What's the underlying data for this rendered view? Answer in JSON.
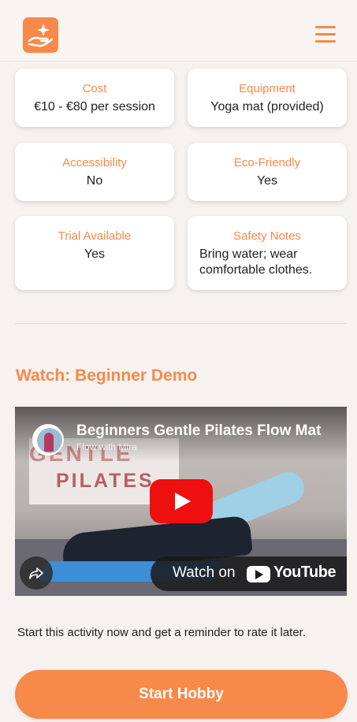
{
  "header": {
    "logo_icon": "hand-sparkle-icon",
    "menu_icon": "hamburger-menu-icon"
  },
  "details": [
    {
      "label": "Cost",
      "value": "€10 - €80 per session"
    },
    {
      "label": "Equipment",
      "value": "Yoga mat (provided)"
    },
    {
      "label": "Accessibility",
      "value": "No"
    },
    {
      "label": "Eco-Friendly",
      "value": "Yes"
    },
    {
      "label": "Trial Available",
      "value": "Yes"
    },
    {
      "label": "Safety Notes",
      "value": "Bring water; wear comfortable clothes."
    }
  ],
  "video_section": {
    "title": "Watch: Beginner Demo",
    "video_title": "Beginners Gentle Pilates Flow Mat",
    "channel": "Flow with Mira",
    "thumbnail_text_1": "GENTLE",
    "thumbnail_text_2": "PILATES",
    "watch_on": "Watch on",
    "youtube": "YouTube"
  },
  "note": "Start this activity now and get a reminder to rate it later.",
  "start_button": "Start Hobby",
  "colors": {
    "accent": "#f7894a",
    "background": "#f5f2ef",
    "card": "#ffffff"
  }
}
